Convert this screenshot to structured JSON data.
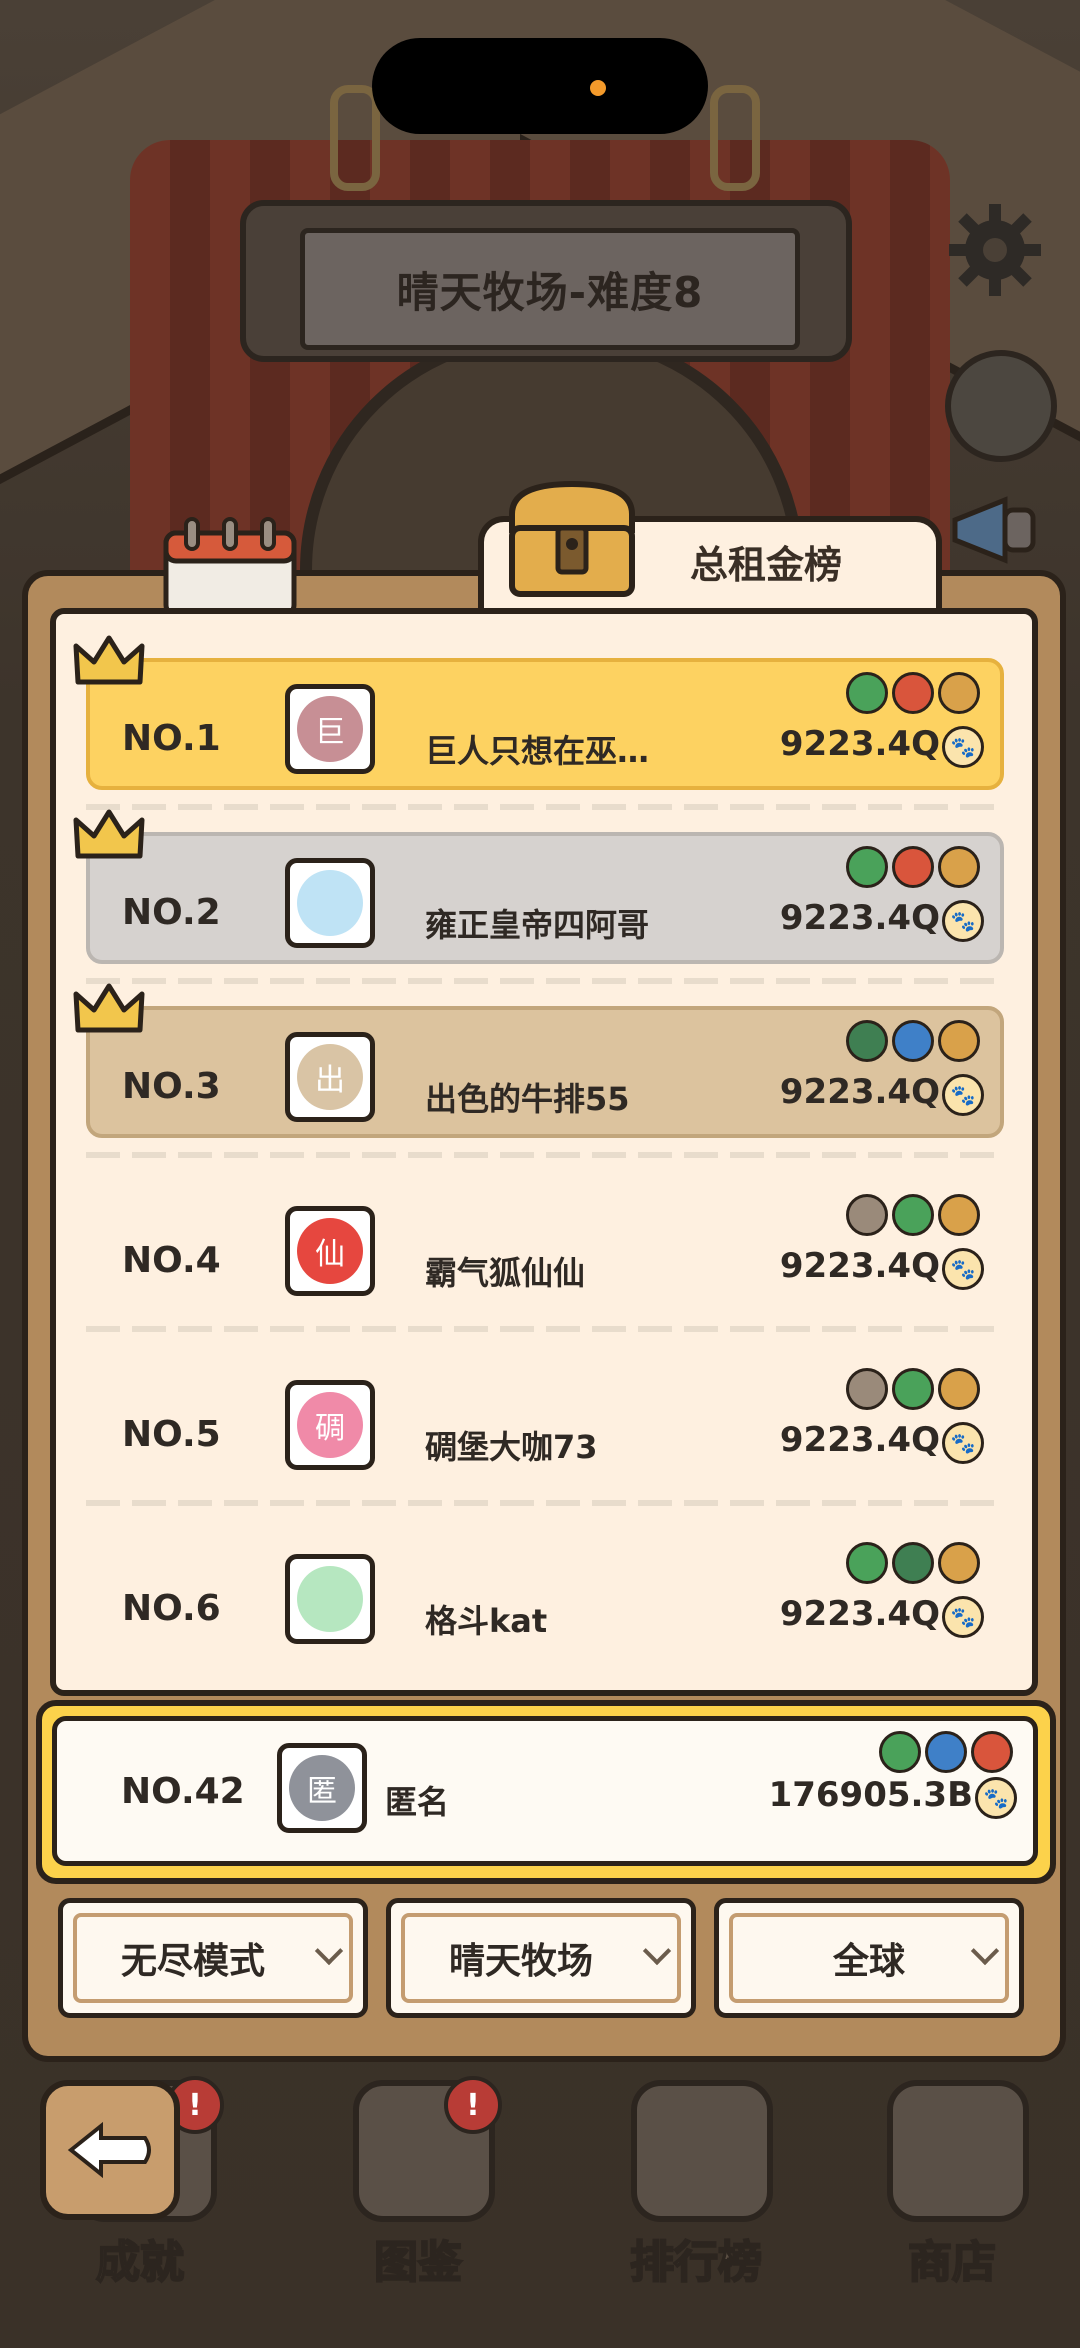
{
  "header": {
    "title": "晴天牧场-难度8"
  },
  "leaderboard": {
    "tab_label": "总租金榜",
    "rows": [
      {
        "rank": "NO.1",
        "avatar_char": "巨",
        "avatar_color": "#c78f95",
        "name": "巨人只想在巫…",
        "score": "9223.4Q",
        "style": "gold",
        "crown": true,
        "badges": [
          "#4aa25a",
          "#d9553c",
          "#d9a14a"
        ]
      },
      {
        "rank": "NO.2",
        "avatar_char": "",
        "avatar_color": "#bfe3f5",
        "name": "雍正皇帝四阿哥",
        "score": "9223.4Q",
        "style": "silver",
        "crown": true,
        "badges": [
          "#4aa25a",
          "#d9553c",
          "#d9a14a"
        ]
      },
      {
        "rank": "NO.3",
        "avatar_char": "出",
        "avatar_color": "#d9c4a5",
        "name": "出色的牛排55",
        "score": "9223.4Q",
        "style": "bronze",
        "crown": true,
        "badges": [
          "#3f7f52",
          "#3f80c8",
          "#d9a14a"
        ]
      },
      {
        "rank": "NO.4",
        "avatar_char": "仙",
        "avatar_color": "#e6473f",
        "name": "霸气狐仙仙",
        "score": "9223.4Q",
        "style": "plain",
        "crown": false,
        "badges": [
          "#9a8a7a",
          "#4aa25a",
          "#d9a14a"
        ]
      },
      {
        "rank": "NO.5",
        "avatar_char": "碉",
        "avatar_color": "#f08aa8",
        "name": "碉堡大咖73",
        "score": "9223.4Q",
        "style": "plain",
        "crown": false,
        "badges": [
          "#9a8a7a",
          "#4aa25a",
          "#d9a14a"
        ]
      },
      {
        "rank": "NO.6",
        "avatar_char": "",
        "avatar_color": "#b6e7c0",
        "name": "格斗kat",
        "score": "9223.4Q",
        "style": "plain",
        "crown": false,
        "badges": [
          "#4aa25a",
          "#3f7f52",
          "#d9a14a"
        ]
      }
    ]
  },
  "my_rank": {
    "rank": "NO.42",
    "avatar_char": "匿",
    "avatar_color": "#8f929a",
    "name": "匿名",
    "score": "176905.3B",
    "badges": [
      "#4aa25a",
      "#3f80c8",
      "#d9553c"
    ]
  },
  "filters": {
    "mode": "无尽模式",
    "map": "晴天牧场",
    "region": "全球"
  },
  "bottom_nav": {
    "achievements": "成就",
    "collection": "图鉴",
    "leaderboard": "排行榜",
    "shop": "商店",
    "notif_mark": "!"
  }
}
